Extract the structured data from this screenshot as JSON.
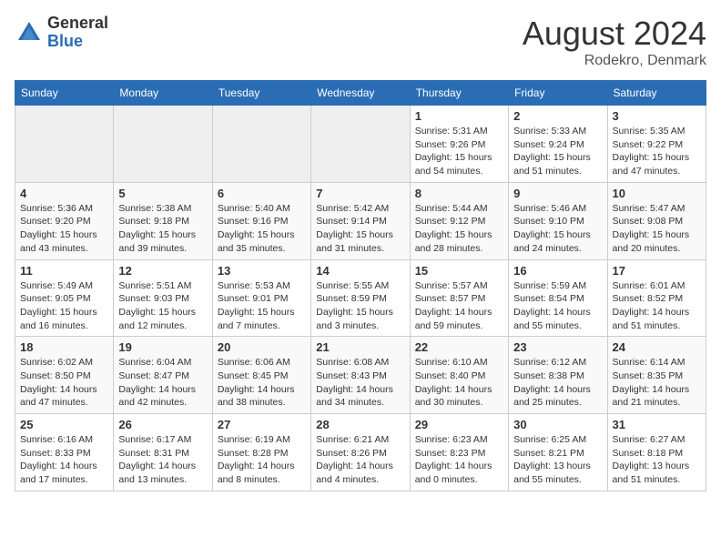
{
  "header": {
    "logo": {
      "general": "General",
      "blue": "Blue"
    },
    "title": "August 2024",
    "location": "Rodekro, Denmark"
  },
  "weekdays": [
    "Sunday",
    "Monday",
    "Tuesday",
    "Wednesday",
    "Thursday",
    "Friday",
    "Saturday"
  ],
  "weeks": [
    [
      {
        "day": "",
        "info": ""
      },
      {
        "day": "",
        "info": ""
      },
      {
        "day": "",
        "info": ""
      },
      {
        "day": "",
        "info": ""
      },
      {
        "day": "1",
        "info": "Sunrise: 5:31 AM\nSunset: 9:26 PM\nDaylight: 15 hours\nand 54 minutes."
      },
      {
        "day": "2",
        "info": "Sunrise: 5:33 AM\nSunset: 9:24 PM\nDaylight: 15 hours\nand 51 minutes."
      },
      {
        "day": "3",
        "info": "Sunrise: 5:35 AM\nSunset: 9:22 PM\nDaylight: 15 hours\nand 47 minutes."
      }
    ],
    [
      {
        "day": "4",
        "info": "Sunrise: 5:36 AM\nSunset: 9:20 PM\nDaylight: 15 hours\nand 43 minutes."
      },
      {
        "day": "5",
        "info": "Sunrise: 5:38 AM\nSunset: 9:18 PM\nDaylight: 15 hours\nand 39 minutes."
      },
      {
        "day": "6",
        "info": "Sunrise: 5:40 AM\nSunset: 9:16 PM\nDaylight: 15 hours\nand 35 minutes."
      },
      {
        "day": "7",
        "info": "Sunrise: 5:42 AM\nSunset: 9:14 PM\nDaylight: 15 hours\nand 31 minutes."
      },
      {
        "day": "8",
        "info": "Sunrise: 5:44 AM\nSunset: 9:12 PM\nDaylight: 15 hours\nand 28 minutes."
      },
      {
        "day": "9",
        "info": "Sunrise: 5:46 AM\nSunset: 9:10 PM\nDaylight: 15 hours\nand 24 minutes."
      },
      {
        "day": "10",
        "info": "Sunrise: 5:47 AM\nSunset: 9:08 PM\nDaylight: 15 hours\nand 20 minutes."
      }
    ],
    [
      {
        "day": "11",
        "info": "Sunrise: 5:49 AM\nSunset: 9:05 PM\nDaylight: 15 hours\nand 16 minutes."
      },
      {
        "day": "12",
        "info": "Sunrise: 5:51 AM\nSunset: 9:03 PM\nDaylight: 15 hours\nand 12 minutes."
      },
      {
        "day": "13",
        "info": "Sunrise: 5:53 AM\nSunset: 9:01 PM\nDaylight: 15 hours\nand 7 minutes."
      },
      {
        "day": "14",
        "info": "Sunrise: 5:55 AM\nSunset: 8:59 PM\nDaylight: 15 hours\nand 3 minutes."
      },
      {
        "day": "15",
        "info": "Sunrise: 5:57 AM\nSunset: 8:57 PM\nDaylight: 14 hours\nand 59 minutes."
      },
      {
        "day": "16",
        "info": "Sunrise: 5:59 AM\nSunset: 8:54 PM\nDaylight: 14 hours\nand 55 minutes."
      },
      {
        "day": "17",
        "info": "Sunrise: 6:01 AM\nSunset: 8:52 PM\nDaylight: 14 hours\nand 51 minutes."
      }
    ],
    [
      {
        "day": "18",
        "info": "Sunrise: 6:02 AM\nSunset: 8:50 PM\nDaylight: 14 hours\nand 47 minutes."
      },
      {
        "day": "19",
        "info": "Sunrise: 6:04 AM\nSunset: 8:47 PM\nDaylight: 14 hours\nand 42 minutes."
      },
      {
        "day": "20",
        "info": "Sunrise: 6:06 AM\nSunset: 8:45 PM\nDaylight: 14 hours\nand 38 minutes."
      },
      {
        "day": "21",
        "info": "Sunrise: 6:08 AM\nSunset: 8:43 PM\nDaylight: 14 hours\nand 34 minutes."
      },
      {
        "day": "22",
        "info": "Sunrise: 6:10 AM\nSunset: 8:40 PM\nDaylight: 14 hours\nand 30 minutes."
      },
      {
        "day": "23",
        "info": "Sunrise: 6:12 AM\nSunset: 8:38 PM\nDaylight: 14 hours\nand 25 minutes."
      },
      {
        "day": "24",
        "info": "Sunrise: 6:14 AM\nSunset: 8:35 PM\nDaylight: 14 hours\nand 21 minutes."
      }
    ],
    [
      {
        "day": "25",
        "info": "Sunrise: 6:16 AM\nSunset: 8:33 PM\nDaylight: 14 hours\nand 17 minutes."
      },
      {
        "day": "26",
        "info": "Sunrise: 6:17 AM\nSunset: 8:31 PM\nDaylight: 14 hours\nand 13 minutes."
      },
      {
        "day": "27",
        "info": "Sunrise: 6:19 AM\nSunset: 8:28 PM\nDaylight: 14 hours\nand 8 minutes."
      },
      {
        "day": "28",
        "info": "Sunrise: 6:21 AM\nSunset: 8:26 PM\nDaylight: 14 hours\nand 4 minutes."
      },
      {
        "day": "29",
        "info": "Sunrise: 6:23 AM\nSunset: 8:23 PM\nDaylight: 14 hours\nand 0 minutes."
      },
      {
        "day": "30",
        "info": "Sunrise: 6:25 AM\nSunset: 8:21 PM\nDaylight: 13 hours\nand 55 minutes."
      },
      {
        "day": "31",
        "info": "Sunrise: 6:27 AM\nSunset: 8:18 PM\nDaylight: 13 hours\nand 51 minutes."
      }
    ]
  ]
}
